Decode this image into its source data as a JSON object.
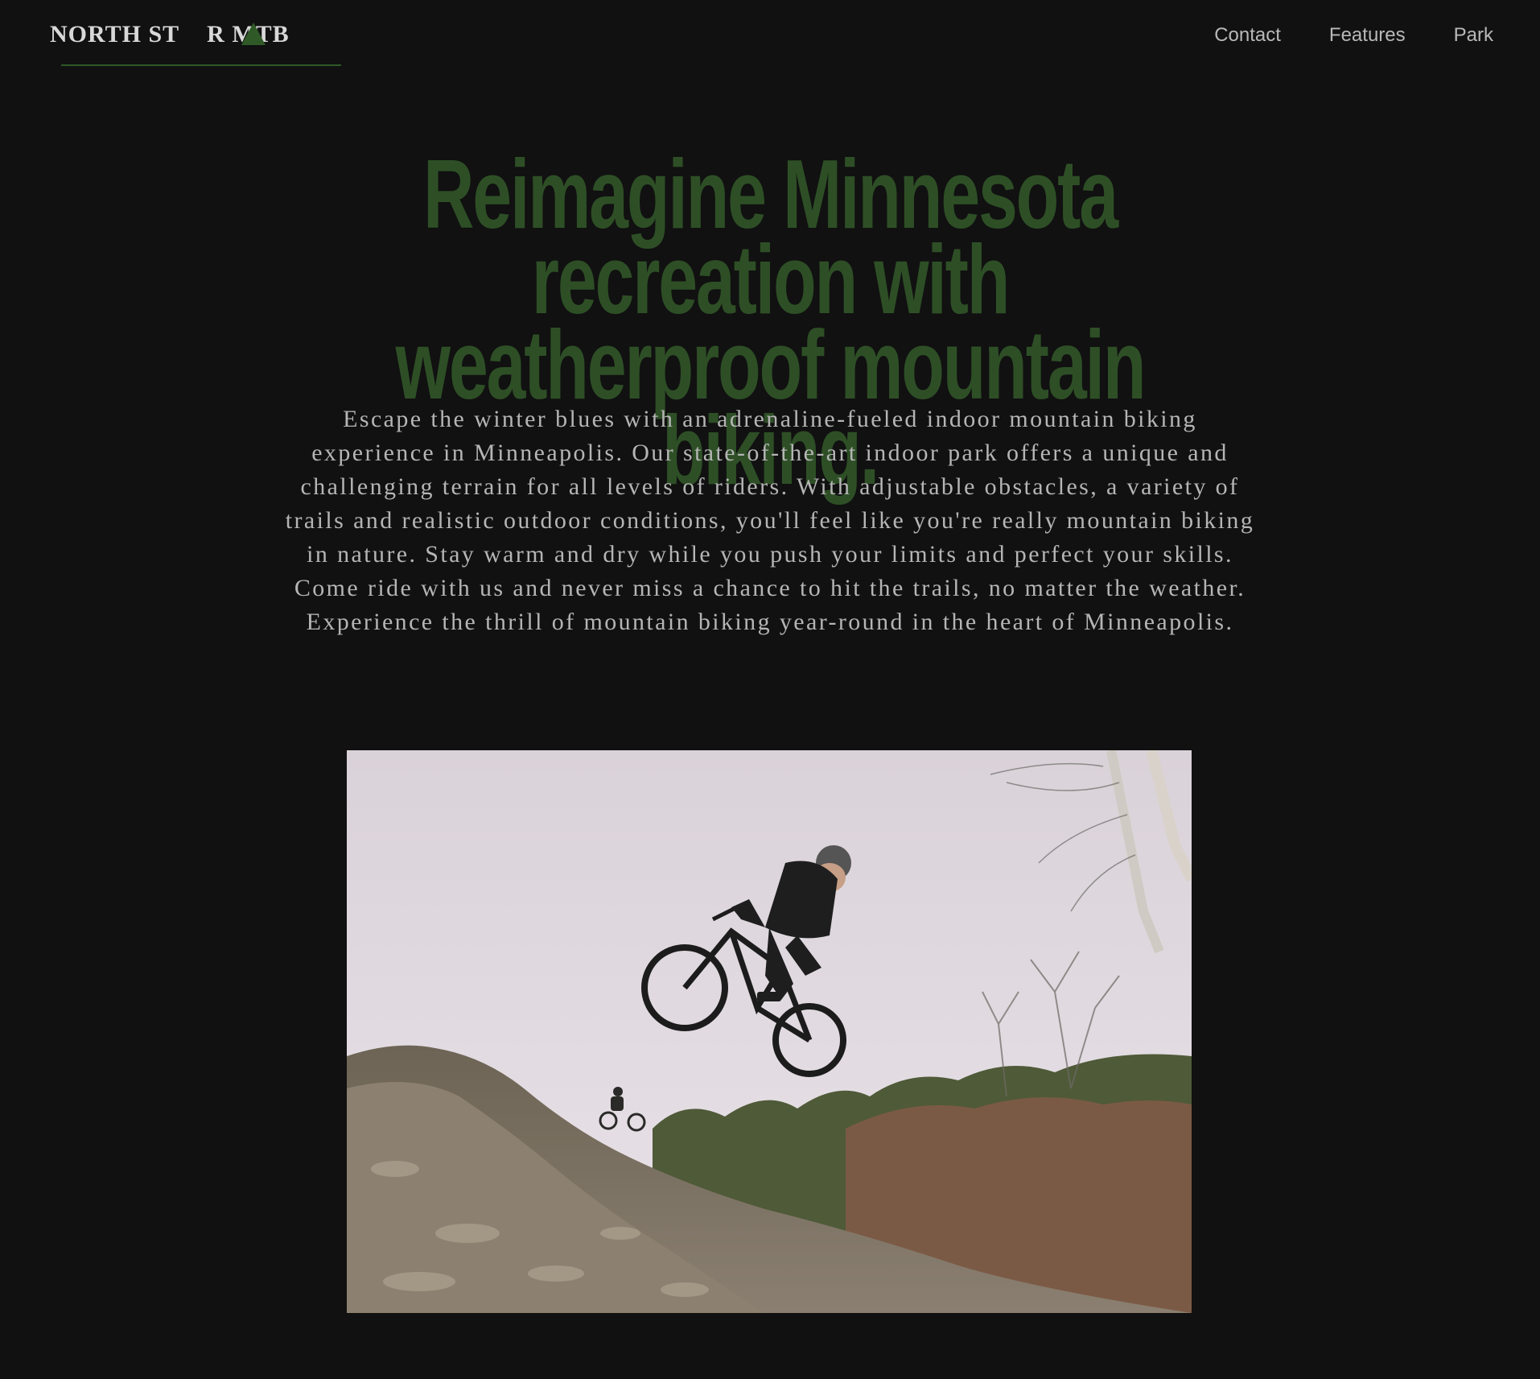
{
  "header": {
    "logo": {
      "text_left": "NORTH ST",
      "text_right": "R MTB"
    },
    "nav": [
      {
        "label": "Contact"
      },
      {
        "label": "Features"
      },
      {
        "label": "Park"
      }
    ]
  },
  "hero": {
    "headline_line1": "Reimagine Minnesota recreation with",
    "headline_line2": "weatherproof mountain biking.",
    "intro": "Escape the winter blues with an adrenaline-fueled indoor mountain biking experience in Minneapolis. Our state-of-the-art indoor park offers a unique and challenging terrain for all levels of riders. With adjustable obstacles, a variety of trails and realistic outdoor conditions, you'll feel like you're really mountain biking in nature. Stay warm and dry while you push your limits and perfect your skills. Come ride with us and never miss a chance to hit the trails, no matter the weather. Experience the thrill of mountain biking year-round in the heart of Minneapolis."
  },
  "colors": {
    "background": "#111111",
    "headline": "#2e4f26",
    "body_text": "#b5b5b5",
    "nav_text": "#b8b8b8",
    "logo_accent": "#2f5a27"
  }
}
